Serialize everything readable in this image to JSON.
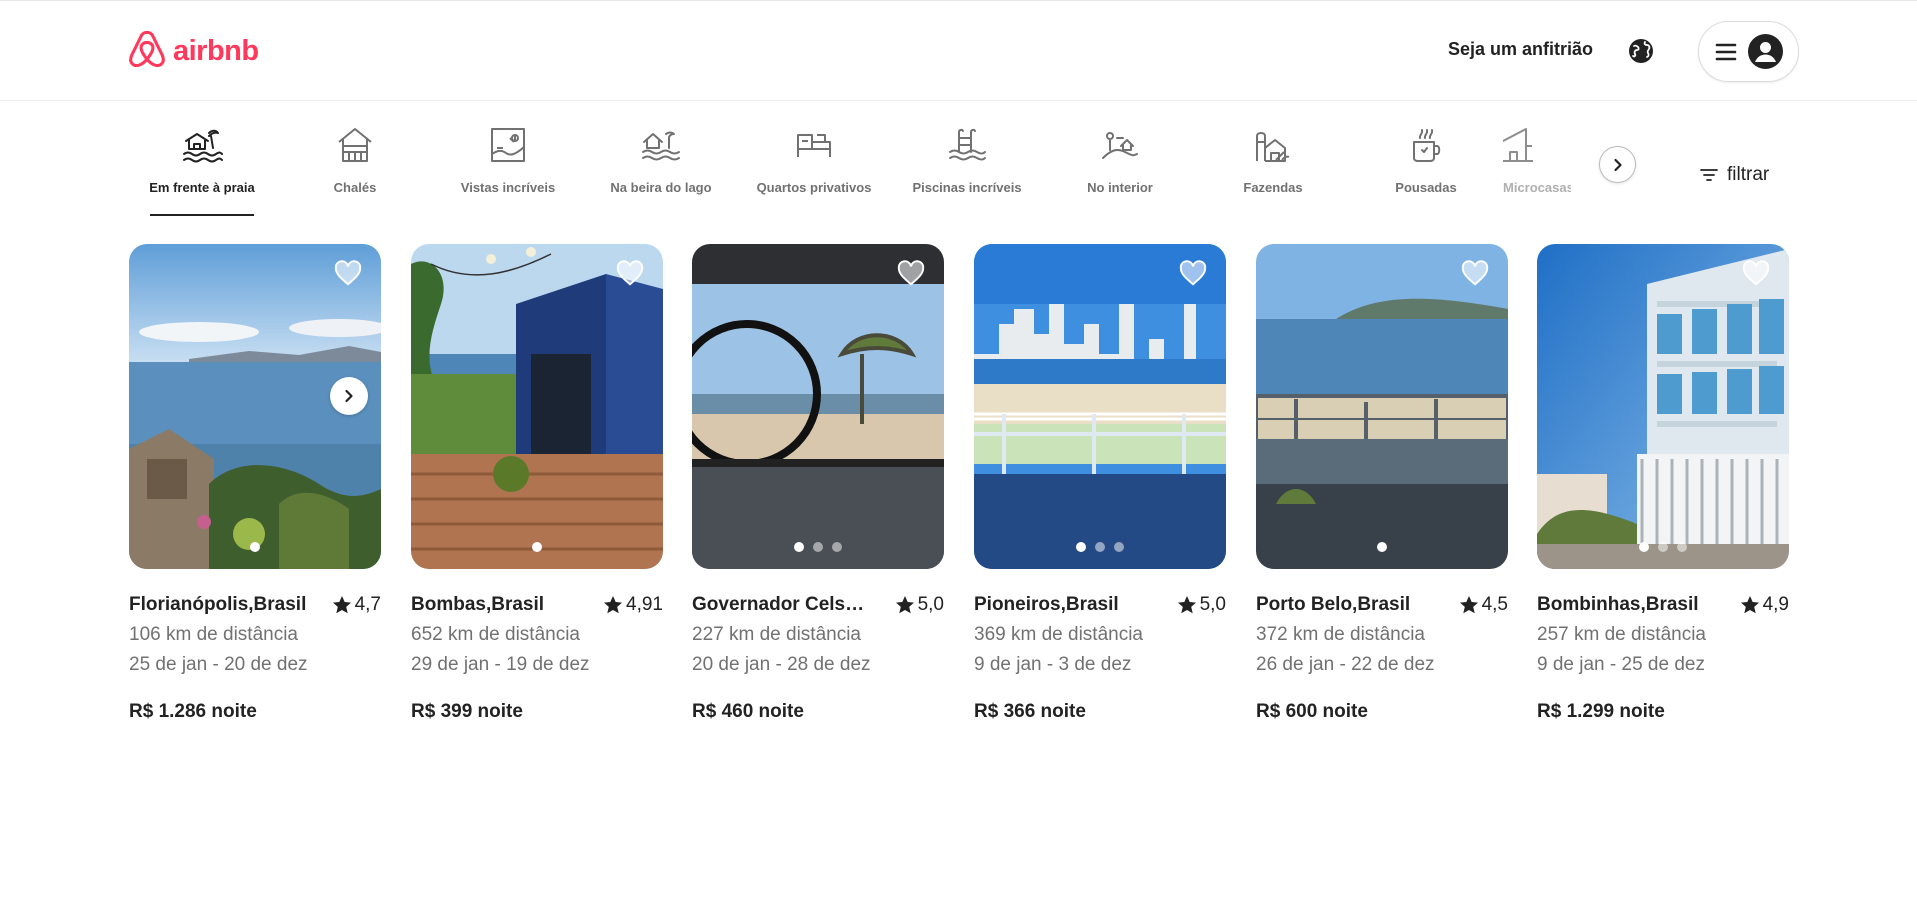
{
  "header": {
    "logo_text": "airbnb",
    "host_link": "Seja um anfitrião",
    "brand_color": "#ff385c"
  },
  "categories": [
    {
      "label": "Em frente à praia",
      "icon": "beach-house-icon",
      "active": true
    },
    {
      "label": "Chalés",
      "icon": "chalet-icon"
    },
    {
      "label": "Vistas incríveis",
      "icon": "framed-view-icon"
    },
    {
      "label": "Na beira do lago",
      "icon": "lakeside-icon"
    },
    {
      "label": "Quartos privativos",
      "icon": "bed-icon"
    },
    {
      "label": "Piscinas incríveis",
      "icon": "pool-icon"
    },
    {
      "label": "No interior",
      "icon": "countryside-icon"
    },
    {
      "label": "Fazendas",
      "icon": "farm-icon"
    },
    {
      "label": "Pousadas",
      "icon": "mug-icon"
    },
    {
      "label": "Microcasas",
      "icon": "tiny-house-icon"
    }
  ],
  "filter_label": "filtrar",
  "listings": [
    {
      "location": "Florianópolis,Brasil",
      "rating": "4,7",
      "distance": "106 km de distância",
      "dates": "25 de jan - 20 de dez",
      "price": "R$ 1.286 noite",
      "dots": 1,
      "active_dot": 0
    },
    {
      "location": "Bombas,Brasil",
      "rating": "4,91",
      "distance": "652 km de distância",
      "dates": "29 de jan - 19 de dez",
      "price": "R$ 399 noite",
      "dots": 1,
      "active_dot": 0
    },
    {
      "location": "Governador Celso Ramos,Brasil",
      "rating": "5,0",
      "distance": "227 km de distância",
      "dates": "20 de jan - 28 de dez",
      "price": "R$ 460 noite",
      "dots": 3,
      "active_dot": 0
    },
    {
      "location": "Pioneiros,Brasil",
      "rating": "5,0",
      "distance": "369 km de distância",
      "dates": "9 de jan - 3 de dez",
      "price": "R$ 366 noite",
      "dots": 3,
      "active_dot": 0
    },
    {
      "location": "Porto Belo,Brasil",
      "rating": "4,5",
      "distance": "372 km de distância",
      "dates": "26 de jan - 22 de dez",
      "price": "R$ 600 noite",
      "dots": 1,
      "active_dot": 0
    },
    {
      "location": "Bombinhas,Brasil",
      "rating": "4,9",
      "distance": "257 km de distância",
      "dates": "9 de jan - 25 de dez",
      "price": "R$ 1.299 noite",
      "dots": 3,
      "active_dot": 0
    }
  ]
}
